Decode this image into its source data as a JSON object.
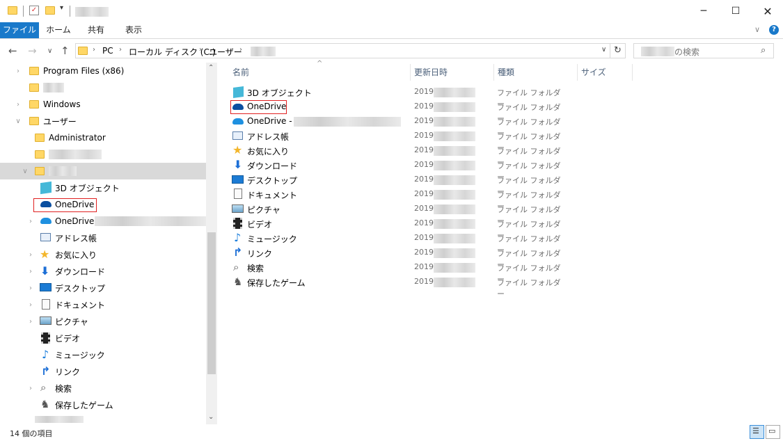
{
  "ribbon": {
    "tabs": [
      "ファイル",
      "ホーム",
      "共有",
      "表示"
    ]
  },
  "address": {
    "crumbs": [
      "PC",
      "ローカル ディスク (C:)",
      "ユーザー"
    ]
  },
  "search": {
    "placeholder": "の検索"
  },
  "nav_pane": [
    {
      "label": "Program Files (x86)"
    },
    {
      "label": ""
    },
    {
      "label": "Windows"
    },
    {
      "label": "ユーザー"
    },
    {
      "label": "Administrator"
    },
    {
      "label": ""
    },
    {
      "label": ""
    },
    {
      "label": "3D オブジェクト"
    },
    {
      "label": "OneDrive"
    },
    {
      "label": "OneDrive -"
    },
    {
      "label": "アドレス帳"
    },
    {
      "label": "お気に入り"
    },
    {
      "label": "ダウンロード"
    },
    {
      "label": "デスクトップ"
    },
    {
      "label": "ドキュメント"
    },
    {
      "label": "ピクチャ"
    },
    {
      "label": "ビデオ"
    },
    {
      "label": "ミュージック"
    },
    {
      "label": "リンク"
    },
    {
      "label": "検索"
    },
    {
      "label": "保存したゲーム"
    }
  ],
  "columns": {
    "name": "名前",
    "date": "更新日時",
    "type": "種類",
    "size": "サイズ"
  },
  "files": [
    {
      "name": "3D オブジェクト",
      "date": "2019/",
      "type": "ファイル フォルダー",
      "icon": "3d-objects-icon"
    },
    {
      "name": "OneDrive",
      "date": "2019/",
      "type": "ファイル フォルダー",
      "icon": "onedrive-icon"
    },
    {
      "name": "OneDrive -",
      "date": "2019/",
      "type": "ファイル フォルダー",
      "icon": "onedrive-icon"
    },
    {
      "name": "アドレス帳",
      "date": "2019/",
      "type": "ファイル フォルダー",
      "icon": "contacts-icon"
    },
    {
      "name": "お気に入り",
      "date": "2019/",
      "type": "ファイル フォルダー",
      "icon": "star-icon"
    },
    {
      "name": "ダウンロード",
      "date": "2019/",
      "type": "ファイル フォルダー",
      "icon": "download-icon"
    },
    {
      "name": "デスクトップ",
      "date": "2019/",
      "type": "ファイル フォルダー",
      "icon": "desktop-icon"
    },
    {
      "name": "ドキュメント",
      "date": "2019/",
      "type": "ファイル フォルダー",
      "icon": "document-icon"
    },
    {
      "name": "ピクチャ",
      "date": "2019/",
      "type": "ファイル フォルダー",
      "icon": "pictures-icon"
    },
    {
      "name": "ビデオ",
      "date": "2019/",
      "type": "ファイル フォルダー",
      "icon": "video-icon"
    },
    {
      "name": "ミュージック",
      "date": "2019/",
      "type": "ファイル フォルダー",
      "icon": "music-icon"
    },
    {
      "name": "リンク",
      "date": "2019/",
      "type": "ファイル フォルダー",
      "icon": "link-icon"
    },
    {
      "name": "検索",
      "date": "2019/",
      "type": "ファイル フォルダー",
      "icon": "search-icon"
    },
    {
      "name": "保存したゲーム",
      "date": "2019/",
      "type": "ファイル フォルダー",
      "icon": "saved-games-icon"
    }
  ],
  "status": {
    "count": "14 個の項目"
  },
  "colors": {
    "accent": "#1979ca",
    "highlight": "#e02020"
  }
}
